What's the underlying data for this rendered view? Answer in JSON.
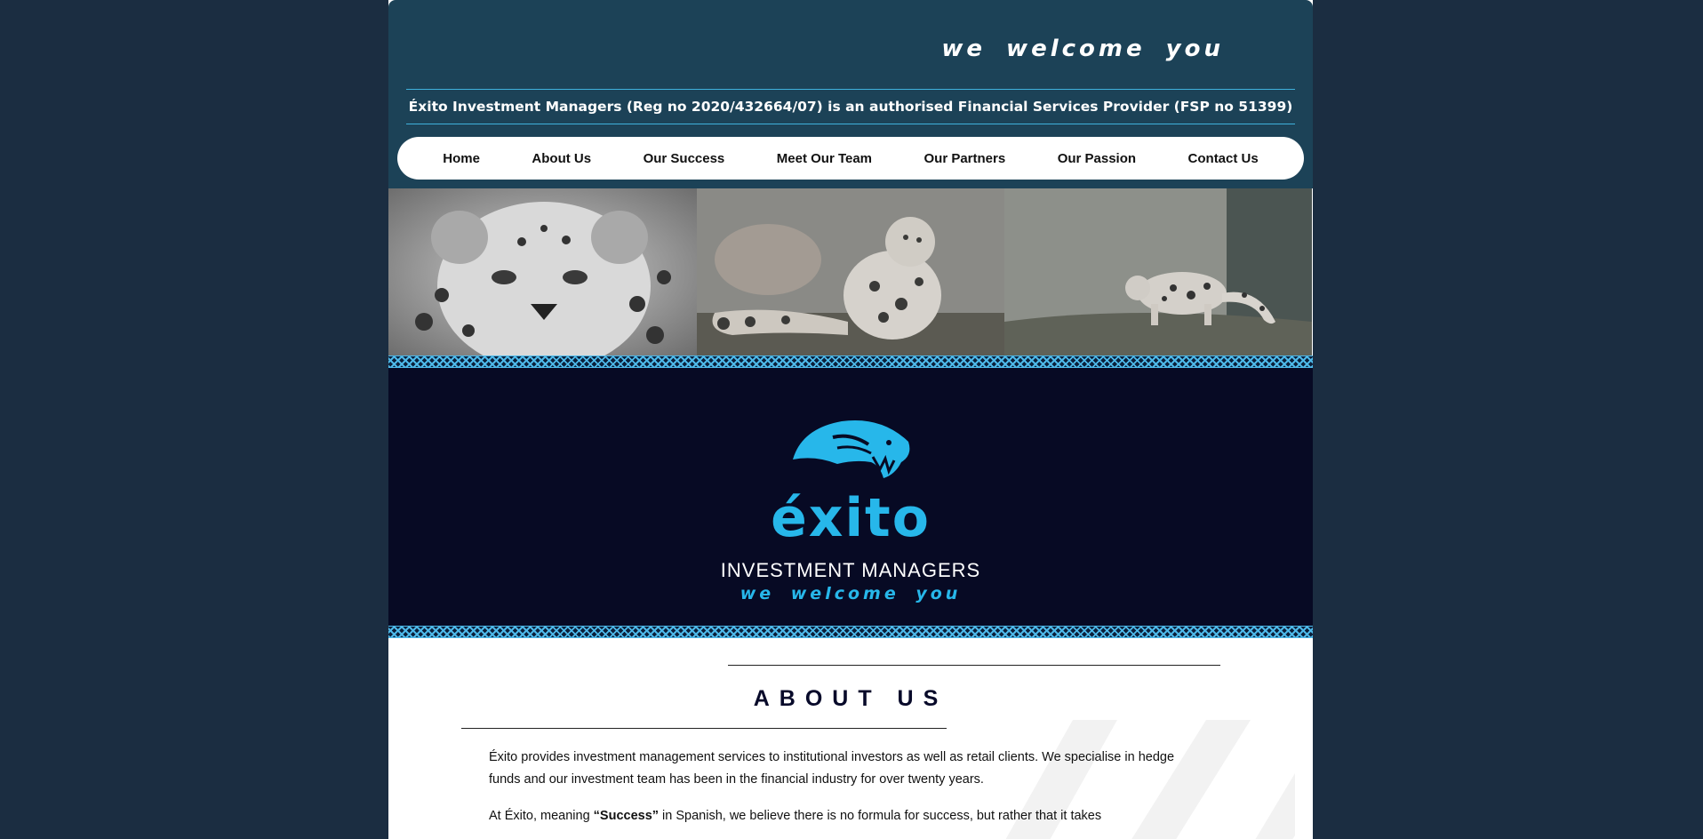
{
  "header": {
    "tagline": "we welcome you",
    "registration": "Éxito Investment Managers (Reg no 2020/432664/07) is an authorised Financial Services Provider (FSP no 51399)"
  },
  "nav": {
    "items": [
      "Home",
      "About Us",
      "Our Success",
      "Meet Our Team",
      "Our Partners",
      "Our Passion",
      "Contact Us"
    ]
  },
  "hero": {
    "logo_word": "éxito",
    "logo_subtitle": "INVESTMENT MANAGERS",
    "logo_tagline": "we welcome you"
  },
  "about": {
    "title": "ABOUT US",
    "paragraph_1": "Éxito provides investment management services to institutional investors as well as retail clients. We specialise in hedge funds and our investment team has been in the financial industry for over twenty years.",
    "paragraph_2_prefix": "At Éxito, meaning ",
    "paragraph_2_bold": "“Success”",
    "paragraph_2_suffix": " in Spanish, we believe there is no formula for success, but rather that it takes"
  },
  "colors": {
    "background": "#1b2d41",
    "header": "#1c4257",
    "hero": "#070a24",
    "accent": "#27b7ea"
  }
}
